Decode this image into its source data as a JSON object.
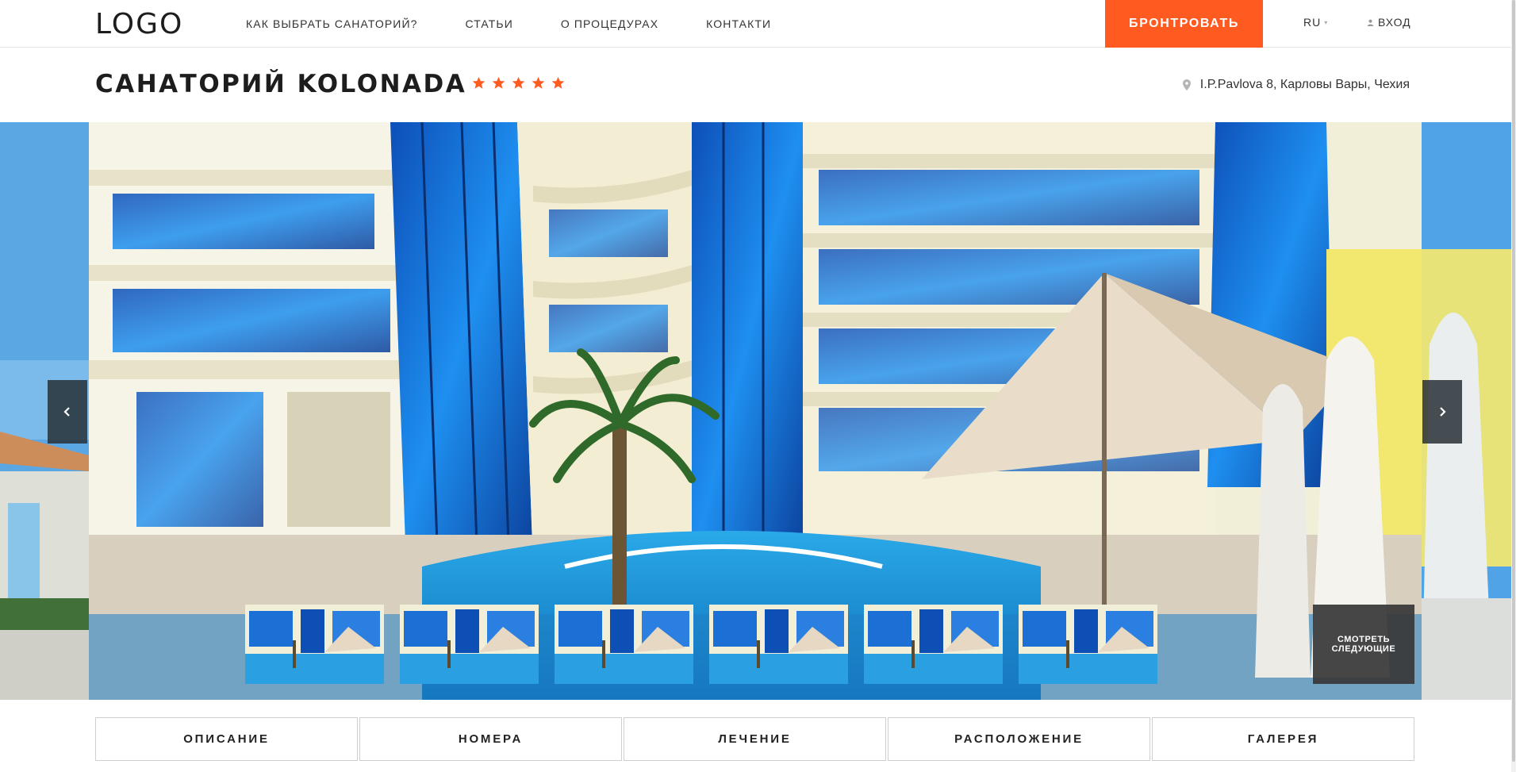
{
  "header": {
    "logo": "LOGO",
    "nav": [
      {
        "label": "КАК ВЫБРАТЬ САНАТОРИЙ?"
      },
      {
        "label": "СТАТЬИ"
      },
      {
        "label": "О ПРОЦЕДУРАХ"
      },
      {
        "label": "КОНТАКТИ"
      }
    ],
    "book_label": "БРОНТРОВАТЬ",
    "lang": "RU",
    "login": "ВХОД"
  },
  "hotel": {
    "title": "САНАТОРИЙ KOLONADA",
    "stars": 5,
    "address": "I.P.Pavlova 8, Карловы Вары, Чехия"
  },
  "gallery": {
    "thumbs_count": 6,
    "see_next_line1": "СМОТРЕТЬ",
    "see_next_line2": "СЛЕДУЮЩИЕ"
  },
  "tabs": [
    {
      "label": "ОПИСАНИЕ"
    },
    {
      "label": "НОМЕРА"
    },
    {
      "label": "ЛЕЧЕНИЕ"
    },
    {
      "label": "РАСПОЛОЖЕНИЕ"
    },
    {
      "label": "ГАЛЕРЕЯ"
    }
  ],
  "colors": {
    "accent": "#ff5a1f",
    "star": "#ff5a1f"
  },
  "icons": {
    "prev": "chevron-left-icon",
    "next": "chevron-right-icon",
    "address": "map-pin-icon",
    "login": "user-icon",
    "star": "star-icon"
  }
}
